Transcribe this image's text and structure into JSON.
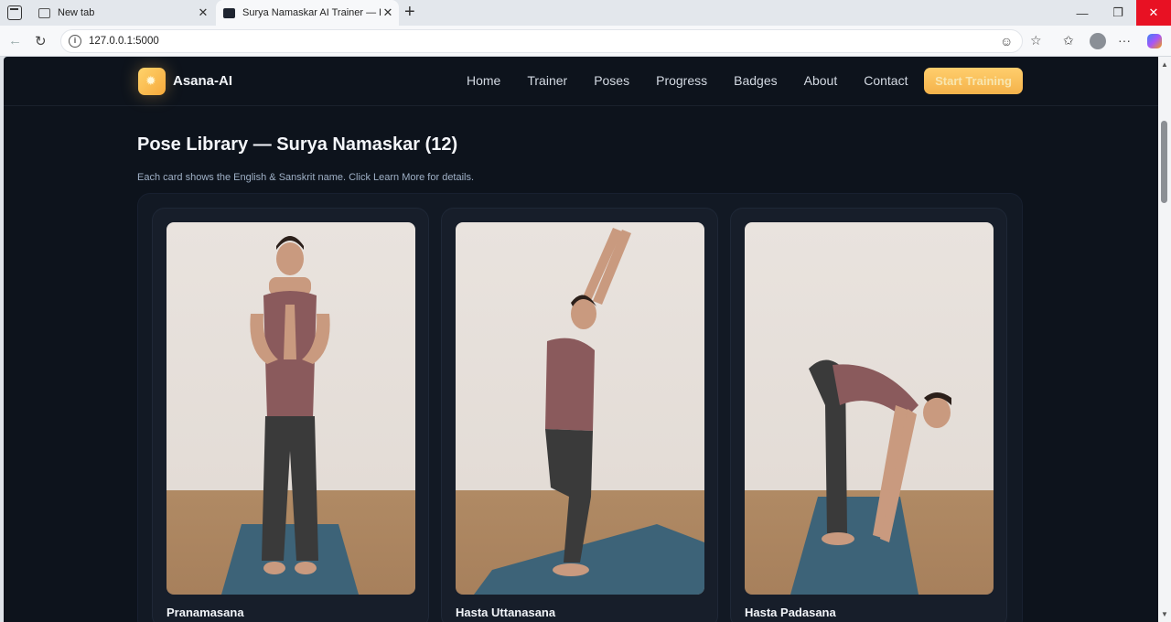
{
  "browser": {
    "tabs": [
      {
        "title": "New tab",
        "active": false
      },
      {
        "title": "Surya Namaskar AI Trainer — Hom",
        "active": true
      }
    ],
    "url": "127.0.0.1:5000"
  },
  "site": {
    "brand": "Asana-AI",
    "nav": [
      "Home",
      "Trainer",
      "Poses",
      "Progress",
      "Badges",
      "About",
      "Contact"
    ],
    "cta": "Start Training"
  },
  "main": {
    "title": "Pose Library — Surya Namaskar (12)",
    "subtitle": "Each card shows the English & Sanskrit name. Click Learn More for details.",
    "cards": [
      {
        "name": "Pranamasana"
      },
      {
        "name": "Hasta Uttanasana"
      },
      {
        "name": "Hasta Padasana"
      }
    ]
  },
  "icons": [
    "tab-menu-icon",
    "page-icon",
    "close-icon",
    "plus-icon",
    "back-icon",
    "reload-icon",
    "info-icon",
    "reader-icon",
    "star-icon",
    "favorites-icon",
    "profile-icon",
    "more-icon",
    "copilot-icon",
    "sun-icon"
  ],
  "colors": {
    "accent": "#f6b24a",
    "page_bg": "#0d131c",
    "card_bg": "#171e2a"
  }
}
